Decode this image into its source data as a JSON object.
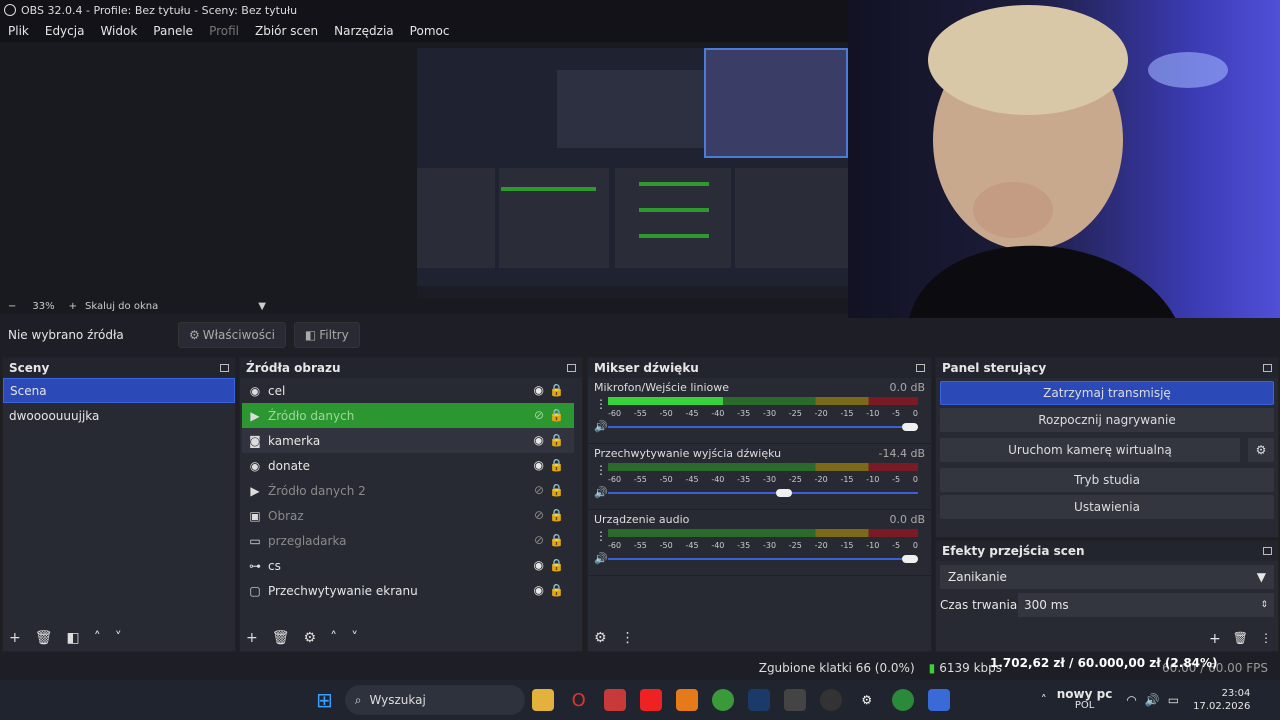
{
  "window": {
    "title": "OBS 32.0.4 - Profile: Bez tytułu - Sceny: Bez tytułu"
  },
  "menu": [
    "Plik",
    "Edycja",
    "Widok",
    "Panele",
    "Profil",
    "Zbiór scen",
    "Narzędzia",
    "Pomoc"
  ],
  "zoom": {
    "minus": "−",
    "value": "33%",
    "plus": "+",
    "mode": "Skaluj do okna"
  },
  "source_toolbar": {
    "none_selected": "Nie wybrano źródła",
    "properties": "Właściwości",
    "filters": "Filtry"
  },
  "scenes": {
    "title": "Sceny",
    "items": [
      "Scena",
      "dwoooouuujjka"
    ],
    "selected": 0
  },
  "sources": {
    "title": "Źródła obrazu",
    "items": [
      {
        "name": "cel",
        "icon": "globe",
        "visible": true,
        "state": "normal"
      },
      {
        "name": "Źródło danych",
        "icon": "play",
        "visible": false,
        "state": "active"
      },
      {
        "name": "kamerka",
        "icon": "camera",
        "visible": true,
        "state": "hover"
      },
      {
        "name": "donate",
        "icon": "globe",
        "visible": true,
        "state": "normal"
      },
      {
        "name": "Źródło danych 2",
        "icon": "play",
        "visible": false,
        "state": "dim"
      },
      {
        "name": "Obraz",
        "icon": "image",
        "visible": false,
        "state": "dim"
      },
      {
        "name": "przegladarka",
        "icon": "window",
        "visible": false,
        "state": "dim"
      },
      {
        "name": "cs",
        "icon": "gamepad",
        "visible": true,
        "state": "normal"
      },
      {
        "name": "Przechwytywanie ekranu",
        "icon": "monitor",
        "visible": true,
        "state": "normal"
      }
    ]
  },
  "mixer": {
    "title": "Mikser dźwięku",
    "ticks": [
      "-60",
      "-55",
      "-50",
      "-45",
      "-40",
      "-35",
      "-30",
      "-25",
      "-20",
      "-15",
      "-10",
      "-5",
      "0"
    ],
    "channels": [
      {
        "name": "Mikrofon/Wejście liniowe",
        "db": "0.0 dB",
        "level": 0.37,
        "volume": 1.0
      },
      {
        "name": "Przechwytywanie wyjścia dźwięku",
        "db": "-14.4 dB",
        "level": 0.0,
        "volume": 0.57
      },
      {
        "name": "Urządzenie audio",
        "db": "0.0 dB",
        "level": 0.0,
        "volume": 1.0
      }
    ]
  },
  "controls": {
    "title": "Panel sterujący",
    "stop_stream": "Zatrzymaj transmisję",
    "start_record": "Rozpocznij nagrywanie",
    "virtual_cam": "Uruchom kamerę wirtualną",
    "studio_mode": "Tryb studia",
    "settings": "Ustawienia"
  },
  "transitions": {
    "title": "Efekty przejścia scen",
    "type": "Zanikanie",
    "duration_label": "Czas trwania",
    "duration_value": "300 ms"
  },
  "status": {
    "dropped": "Zgubione klatki 66 (0.0%)",
    "kbps": "6139 kbps",
    "fps": "60.00 / 60.00 FPS"
  },
  "overlay": {
    "money": "1.702,62 zł / 60.000,00 zł (2.84%)"
  },
  "taskbar": {
    "search": "Wyszukaj",
    "tray_news": "nowy pc",
    "lang": "POL",
    "time": "23:04",
    "date": "17.02.2026"
  },
  "colors": {
    "accent": "#2b4ab7",
    "active_source": "#2c9630",
    "meter_green": "#3ad23a"
  }
}
